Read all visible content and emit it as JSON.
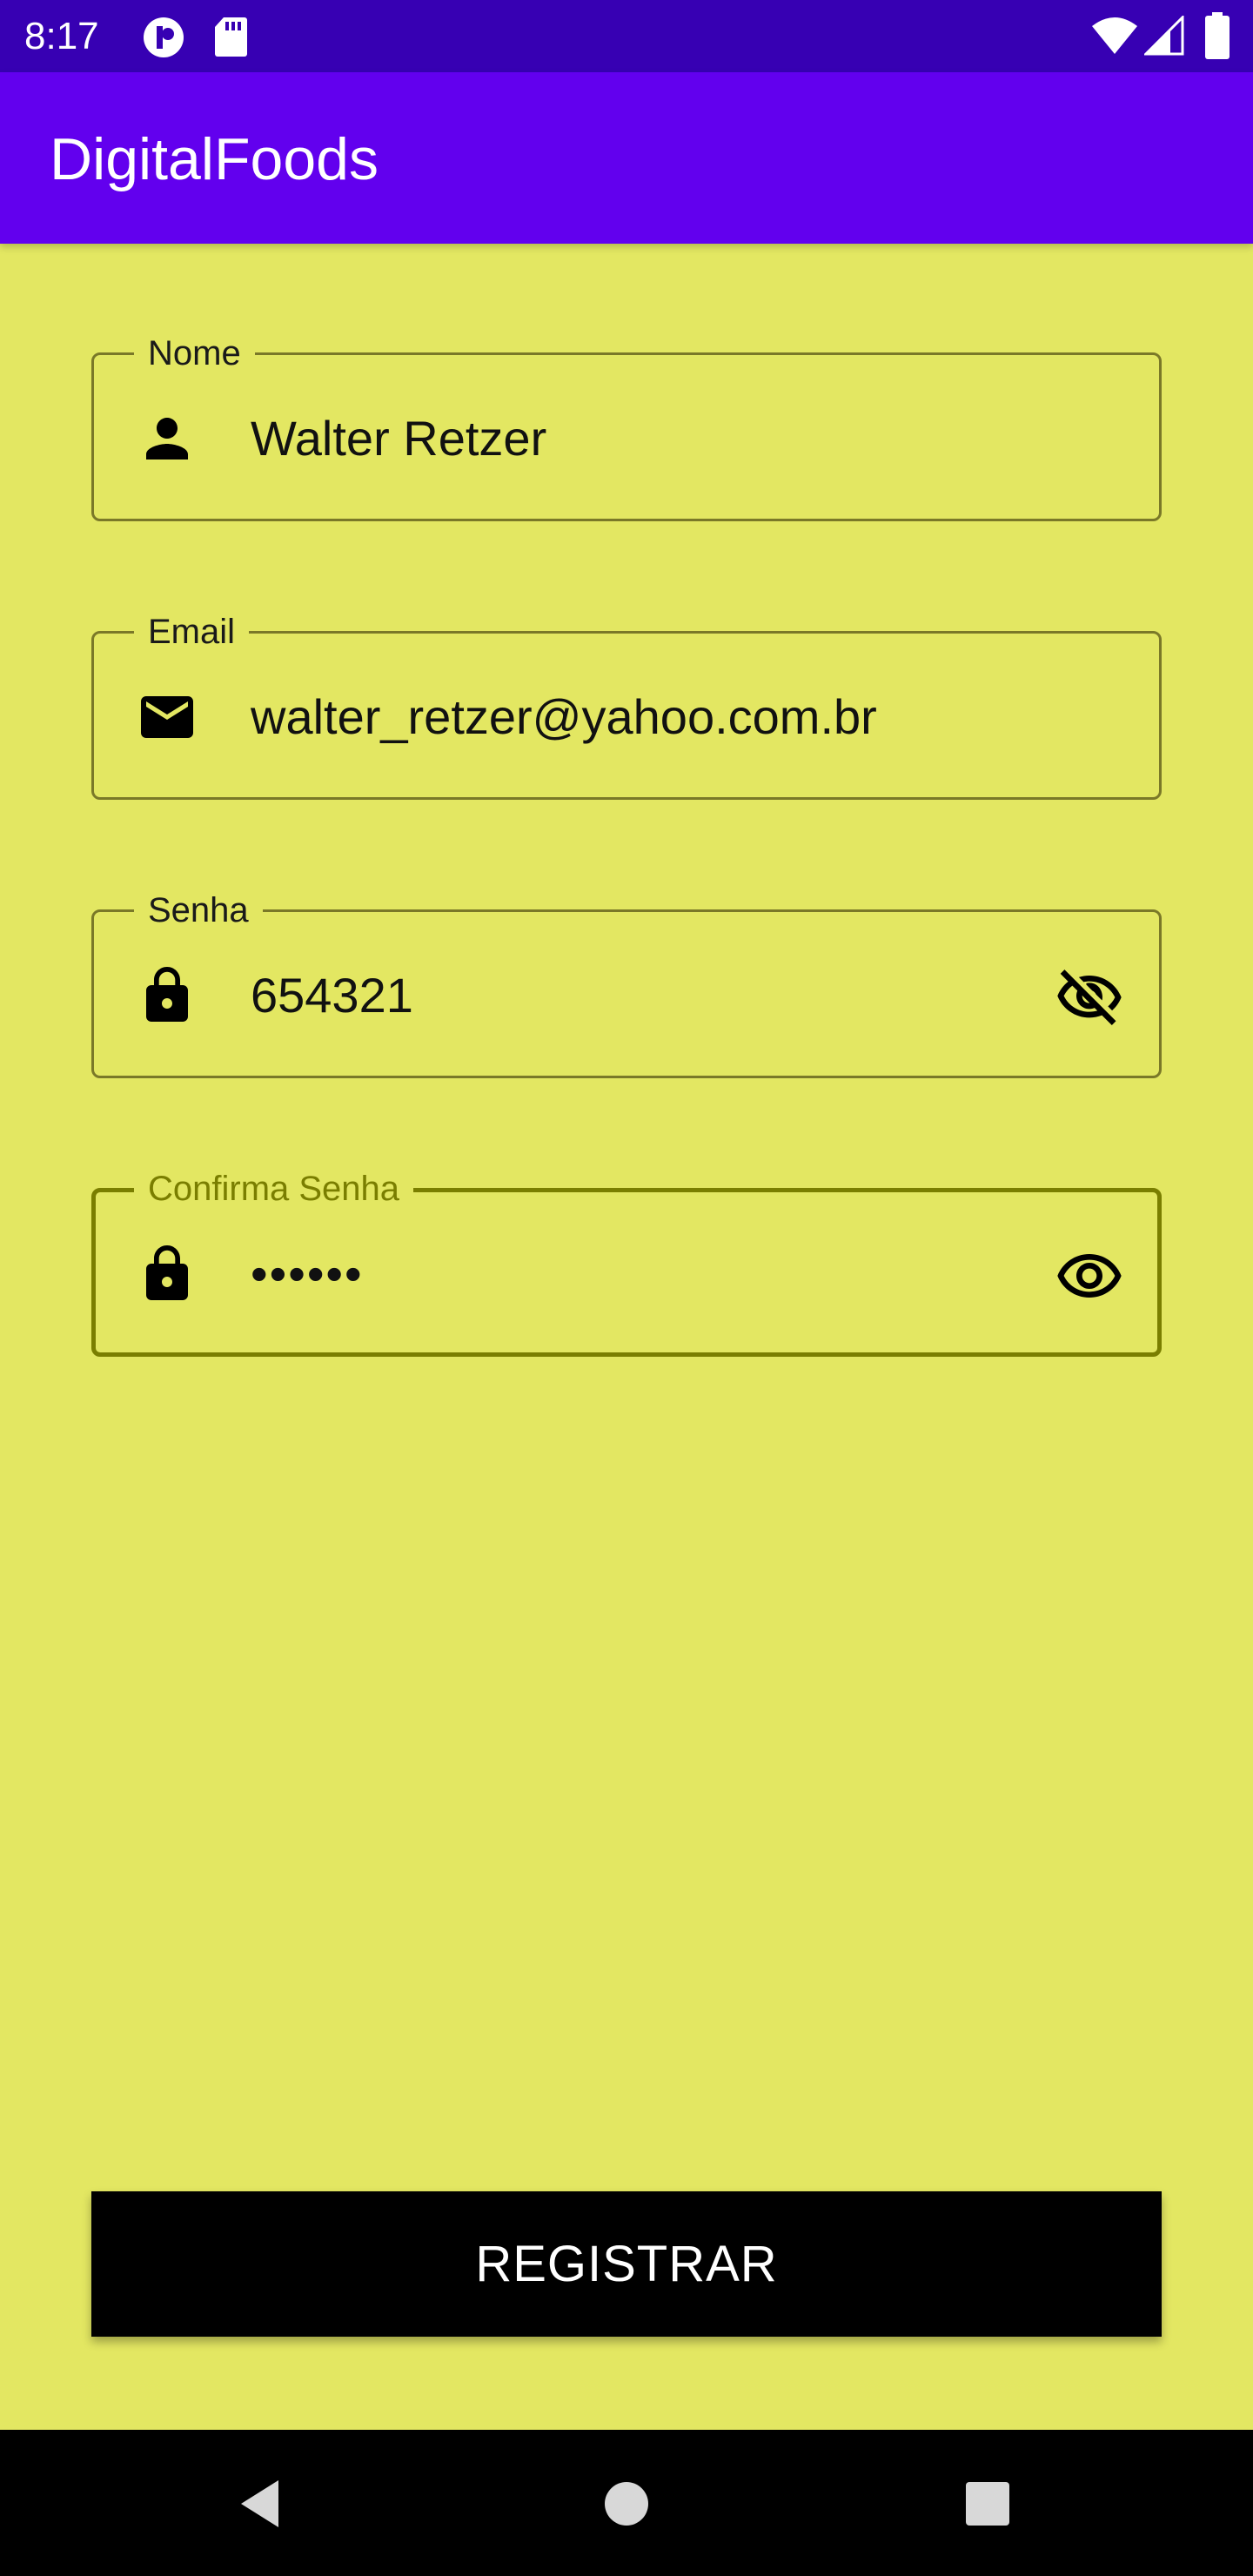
{
  "status_bar": {
    "time": "8:17",
    "icons": [
      "p-circle-icon",
      "sd-card-icon",
      "wifi-icon",
      "signal-icon",
      "battery-icon"
    ]
  },
  "app_bar": {
    "title": "DigitalFoods"
  },
  "form": {
    "name": {
      "label": "Nome",
      "value": "Walter Retzer",
      "icon": "person-icon"
    },
    "email": {
      "label": "Email",
      "value": "walter_retzer@yahoo.com.br",
      "icon": "email-icon"
    },
    "password": {
      "label": "Senha",
      "value": "654321",
      "icon": "lock-icon",
      "toggle_icon": "visibility-off-icon"
    },
    "confirm_password": {
      "label": "Confirma Senha",
      "value": "••••••",
      "icon": "lock-icon",
      "toggle_icon": "visibility-icon"
    }
  },
  "register_button": {
    "label": "REGISTRAR"
  },
  "colors": {
    "background": "#e3e762",
    "app_bar": "#6200ee",
    "status_bar": "#3700b3",
    "focused_outline": "#7a7e00",
    "button": "#000000"
  },
  "nav_bar": {
    "icons": [
      "back-icon",
      "home-icon",
      "recents-icon"
    ]
  }
}
